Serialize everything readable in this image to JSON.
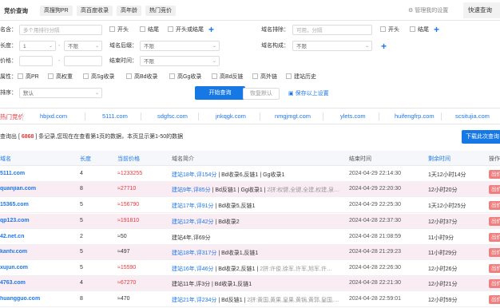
{
  "tabs": {
    "active": "竞价查询",
    "items": [
      "高搜狗PR",
      "高百度收录",
      "高年龄",
      "热门竞价"
    ]
  },
  "top_right": {
    "manage_settings": "管理我的设置",
    "quick_query_prefix": "快速查询(",
    "quick_query_count": "2"
  },
  "form": {
    "name_label": "名含：",
    "name_placeholder": "多个用排行分隔",
    "cb_start": "开头",
    "cb_end": "结尾",
    "cb_start_or_end": "开头或结尾",
    "exclude_label": "域名排除：",
    "exclude_placeholder": "可用，分隔",
    "cb_start2": "开头",
    "cb_end2": "结尾",
    "length_label": "长度：",
    "length_from": "1",
    "length_to": "不限",
    "suffix_label": "域名后缀：",
    "suffix_value": "不限",
    "structure_label": "域名构成：",
    "structure_value": "不限",
    "price_label": "价格：",
    "end_time_label": "结束时间：",
    "end_time_value": "不限",
    "attr_label": "属性：",
    "attrs": [
      "高PR",
      "高权重",
      "高Sg收录",
      "高Bd收录",
      "高Gg收录",
      "高Bd反链",
      "高外链",
      "建站历史"
    ],
    "sort_label": "排序：",
    "sort_value": "默认",
    "search_button": "开始查询",
    "reset_button": "恢复默认",
    "save_link": "保存以上设置"
  },
  "sites": [
    "热门竞价",
    "hbjxd.com",
    "5111.com",
    "sdgfsc.com",
    "jnkqgk.com",
    "nmgjmgt.com",
    "ylets.com",
    "huifengfrp.com",
    "scsitujia.com"
  ],
  "summary": {
    "prefix": "查询出 [ ",
    "count": "6868",
    "suffix": " ] 条记录,您现在在查看第1页的数据，本页显示第1-50的数据"
  },
  "download_button": "下载此次查询",
  "table": {
    "headers": {
      "domain": "域名",
      "length": "长度",
      "price": "当前价格",
      "intro": "域名简介",
      "end": "结束时间",
      "remain": "剩余时间",
      "op": "操作"
    },
    "rows": [
      {
        "domain": "5111.com",
        "length": "4",
        "price": "≈1233255",
        "red": true,
        "intro_blue": "建站18年,评154分",
        "intro_rest": "| Bd收录6,反链1 | Gg收录1",
        "intro_gray": "",
        "end": "2024-04-29 22:14:30",
        "remain": "1天12小时14分",
        "op": "出价"
      },
      {
        "domain": "quanjian.com",
        "length": "8",
        "price": "≈27710",
        "red": true,
        "intro_blue": "建站9年,评85分",
        "intro_rest": "| Bd反链1 | Gg收录1 |",
        "intro_gray": "2拼:权健,全键,全建,权建,泉…",
        "end": "2024-04-29 22:20:30",
        "remain": "12小时20分",
        "op": "出价"
      },
      {
        "domain": "15365.com",
        "length": "5",
        "price": "≈156790",
        "red": true,
        "intro_blue": "建站17年,评91分",
        "intro_rest": "| Bd收录5,反链1",
        "intro_gray": "",
        "end": "2024-04-29 22:25:30",
        "remain": "1天12小时25分",
        "op": "出价"
      },
      {
        "domain": "qp123.com",
        "length": "5",
        "price": "≈191810",
        "red": true,
        "intro_blue": "建站12年,评42分",
        "intro_rest": "| Bd收录2",
        "intro_gray": "",
        "end": "2024-04-28 22:37:30",
        "remain": "12小时37分",
        "op": "出价"
      },
      {
        "domain": "42.net.cn",
        "length": "2",
        "price": "≈50",
        "red": false,
        "intro_blue": "",
        "intro_rest": "建站4年,评69分",
        "intro_gray": "",
        "end": "2024-04-28 21:08:59",
        "remain": "11小时9分",
        "op": "出价"
      },
      {
        "domain": "kantv.com",
        "length": "5",
        "price": "≈497",
        "red": false,
        "intro_blue": "建站18年,评317分",
        "intro_rest": "| Bd收录1,反链1",
        "intro_gray": "",
        "end": "2024-04-28 21:29:23",
        "remain": "11小时29分",
        "op": "出价"
      },
      {
        "domain": "xujun.com",
        "length": "5",
        "price": "≈15590",
        "red": true,
        "intro_blue": "建站16年,评46分",
        "intro_rest": "| Bd收录2,反链1 |",
        "intro_gray": "2拼:许俊,徐军,许军,旭军,许…",
        "end": "2024-04-28 22:26:30",
        "remain": "12小时26分",
        "op": "出价"
      },
      {
        "domain": "4763.com",
        "length": "4",
        "price": "≈67270",
        "red": true,
        "intro_blue": "",
        "intro_rest": "建站11年,评3分 | Bd收录1,反链1",
        "intro_gray": "",
        "end": "2024-04-28 22:21:30",
        "remain": "12小时21分",
        "op": "出价"
      },
      {
        "domain": "huangguo.com",
        "length": "8",
        "price": "≈470",
        "red": false,
        "intro_blue": "建站21年,评234分",
        "intro_rest": "| Bd反链1 |",
        "intro_gray": "2拼:黄国,黄果,皇果,黄锅,黄郭,皇国,…",
        "end": "2024-04-28 22:59:01",
        "remain": "12小时59分",
        "op": "出价"
      }
    ]
  },
  "colors": {
    "accent": "#1678e5",
    "link": "#1e78e6",
    "price_red": "#e4393c",
    "row_pink": "#f9ecf3",
    "op_button": "#f08080"
  }
}
